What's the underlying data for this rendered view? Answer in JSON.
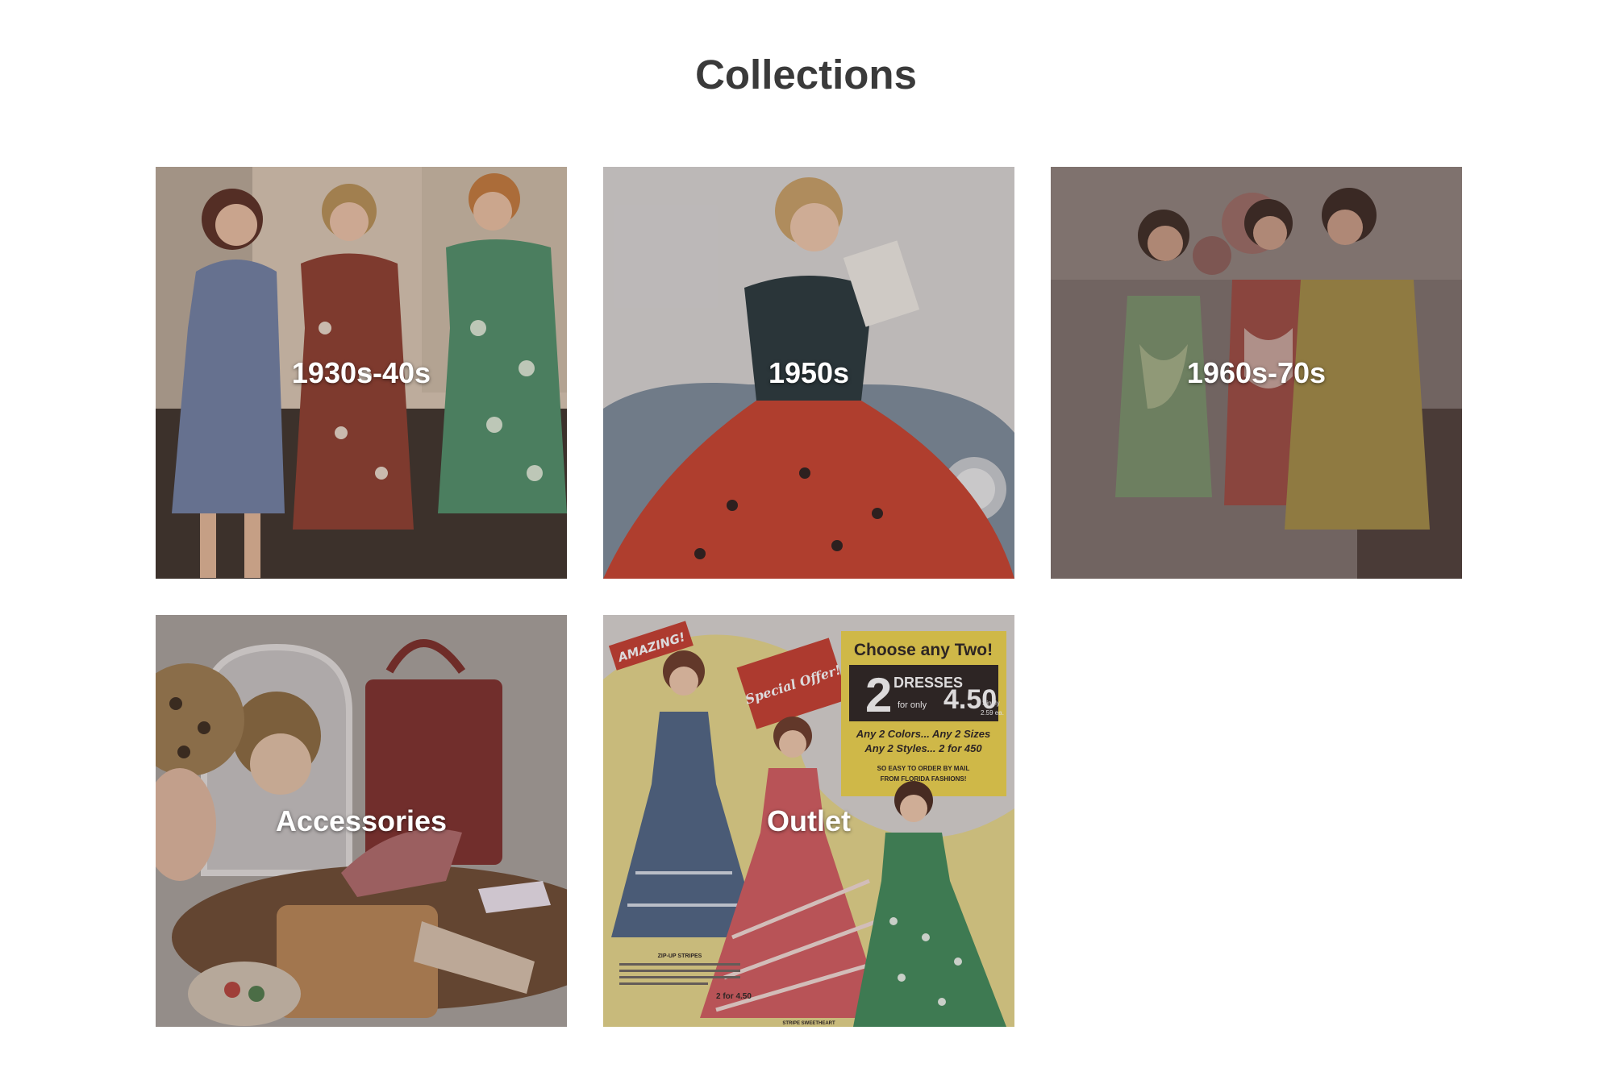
{
  "page": {
    "title": "Collections"
  },
  "collections": [
    {
      "label": "1930s-40s",
      "image": "three-women-1940s-dresses"
    },
    {
      "label": "1950s",
      "image": "woman-red-skirt-vintage-car"
    },
    {
      "label": "1960s-70s",
      "image": "three-women-mod-shift-dresses"
    },
    {
      "label": "Accessories",
      "image": "vintage-handbag-gloves-mirror"
    },
    {
      "label": "Outlet",
      "image": "special-offer-dress-ad"
    }
  ],
  "outlet_ad": {
    "amazing": "AMAZING!",
    "special_offer": "Special Offer!",
    "choose": "Choose any Two!",
    "dresses_count": "2",
    "dresses": "DRESSES",
    "for_only": "for only",
    "price": "4.50",
    "singly": "Singly",
    "singly_price": "2.59 ea.",
    "colors_sizes": "Any 2 Colors... Any 2 Sizes",
    "styles": "Any 2 Styles... 2 for 450",
    "order_by_mail": "SO EASY TO ORDER BY MAIL",
    "from": "FROM FLORIDA FASHIONS!",
    "zip_up": "ZIP-UP STRIPES",
    "two_for": "2 for 4.50",
    "stripe_sweetheart": "STRIPE SWEETHEART"
  },
  "colors": {
    "title": "#3a3a3a",
    "label": "#ffffff",
    "background": "#ffffff"
  }
}
